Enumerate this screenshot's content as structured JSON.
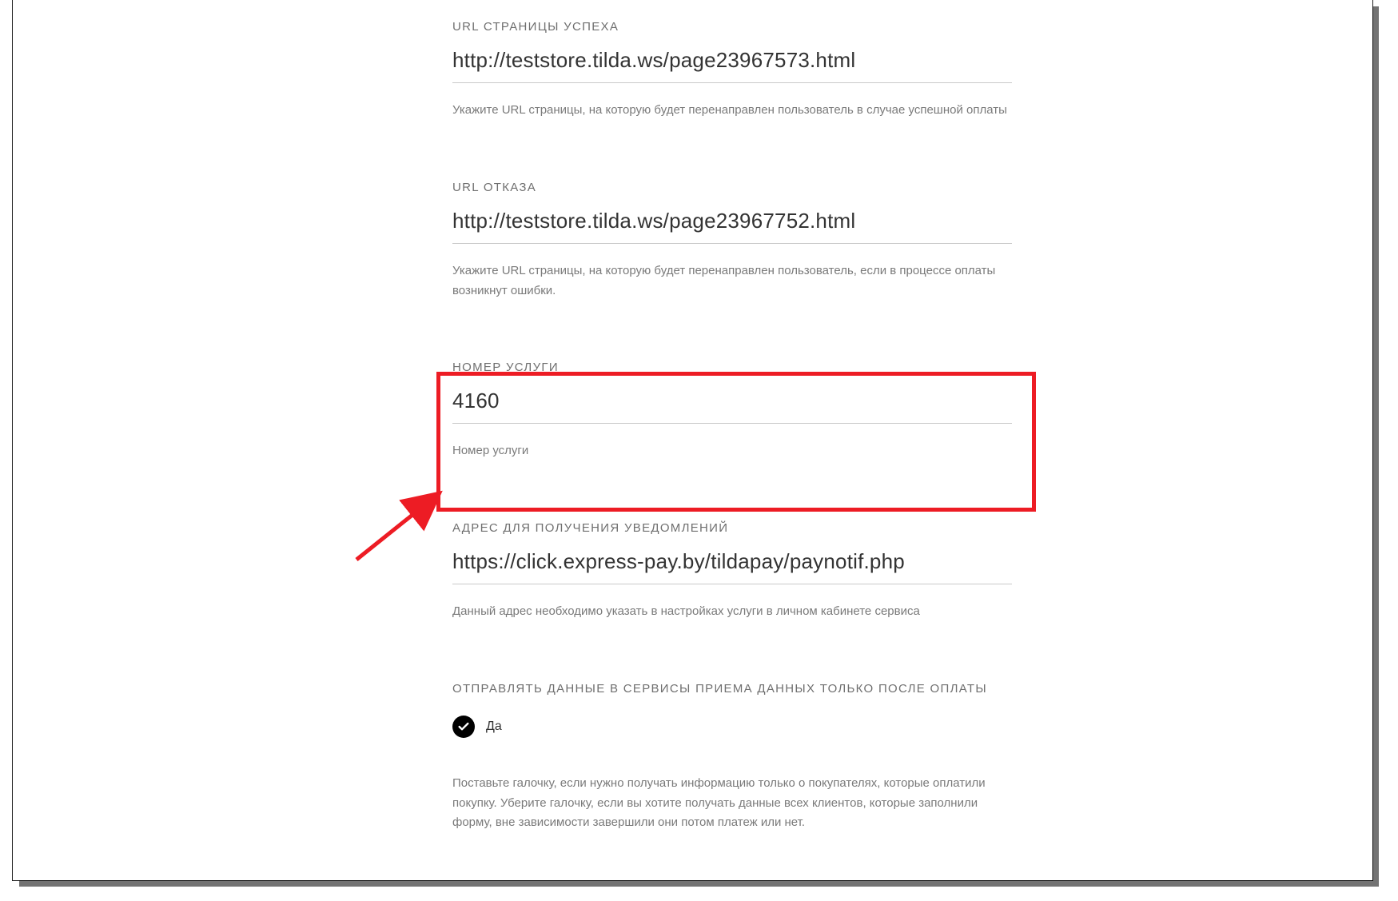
{
  "fields": {
    "success_url": {
      "label": "URL СТРАНИЦЫ УСПЕХА",
      "value": "http://teststore.tilda.ws/page23967573.html",
      "hint": "Укажите URL страницы, на которую будет перенаправлен пользователь в случае успешной оплаты"
    },
    "reject_url": {
      "label": "URL ОТКАЗА",
      "value": "http://teststore.tilda.ws/page23967752.html",
      "hint": "Укажите URL страницы, на которую будет перенаправлен пользователь, если в процессе оплаты возникнут ошибки."
    },
    "service_number": {
      "label": "НОМЕР УСЛУГИ",
      "value": "4160",
      "hint": "Номер услуги"
    },
    "notify_url": {
      "label": "АДРЕС ДЛЯ ПОЛУЧЕНИЯ УВЕДОМЛЕНИЙ",
      "value": "https://click.express-pay.by/tildapay/paynotif.php",
      "hint": "Данный адрес необходимо указать в настройках услуги в личном кабинете сервиса"
    }
  },
  "send_after_payment": {
    "heading": "ОТПРАВЛЯТЬ ДАННЫЕ В СЕРВИСЫ ПРИЕМА ДАННЫХ ТОЛЬКО ПОСЛЕ ОПЛАТЫ",
    "option_label": "Да",
    "hint": "Поставьте галочку, если нужно получать информацию только о покупателях, которые оплатили покупку. Уберите галочку, если вы хотите получать данные всех клиентов, которые заполнили форму, вне зависимости завершили они потом платеж или нет."
  }
}
